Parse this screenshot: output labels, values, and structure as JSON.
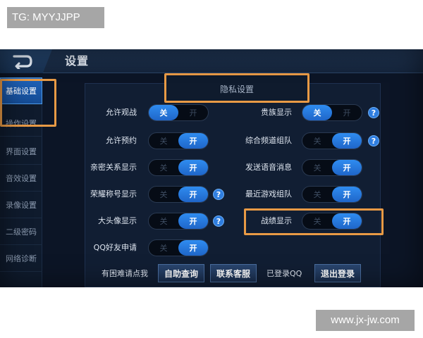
{
  "watermark": {
    "top_left": "TG: MYYJJPP",
    "bottom_right": "www.jx-jw.com"
  },
  "header": {
    "title": "设置",
    "back_icon": "back-arrow-icon"
  },
  "sidebar": {
    "items": [
      {
        "label": "基础设置",
        "active": true
      },
      {
        "label": "操作设置"
      },
      {
        "label": "界面设置"
      },
      {
        "label": "音效设置"
      },
      {
        "label": "录像设置"
      },
      {
        "label": "二级密码"
      },
      {
        "label": "网络诊断"
      }
    ]
  },
  "section": {
    "title": "隐私设置"
  },
  "toggle_labels": {
    "on": "开",
    "off": "关"
  },
  "help_symbol": "?",
  "settings_left": [
    {
      "label": "允许观战",
      "value": "off",
      "help": false
    },
    {
      "label": "允许预约",
      "value": "on",
      "help": false
    },
    {
      "label": "亲密关系显示",
      "value": "on",
      "help": false
    },
    {
      "label": "荣耀称号显示",
      "value": "on",
      "help": true
    },
    {
      "label": "大头像显示",
      "value": "on",
      "help": true
    },
    {
      "label": "QQ好友申请",
      "value": "on",
      "help": false
    }
  ],
  "settings_right": [
    {
      "label": "贵族显示",
      "value": "off",
      "help": true
    },
    {
      "label": "综合频道组队",
      "value": "on",
      "help": true
    },
    {
      "label": "发送语音消息",
      "value": "on",
      "help": false
    },
    {
      "label": "最近游戏组队",
      "value": "on",
      "help": false
    },
    {
      "label": "战绩显示",
      "value": "on",
      "help": false
    }
  ],
  "footer": {
    "help_text": "有困难请点我",
    "self_query_button": "自助查询",
    "contact_button": "联系客服",
    "logged_in_text": "已登录QQ",
    "logout_button": "退出登录"
  },
  "colors": {
    "highlight": "#e89a45",
    "toggle_on": "#2f8cf0",
    "background": "#0c1526"
  }
}
